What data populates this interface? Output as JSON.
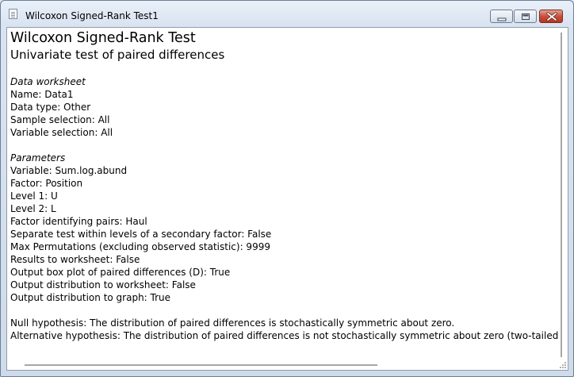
{
  "window": {
    "title": "Wilcoxon Signed-Rank Test1"
  },
  "report": {
    "title": "Wilcoxon Signed-Rank Test",
    "subtitle": "Univariate test of paired differences",
    "data_section": {
      "heading": "Data worksheet",
      "lines": [
        "Name: Data1",
        "Data type: Other",
        "Sample selection: All",
        "Variable selection: All"
      ]
    },
    "params_section": {
      "heading": "Parameters",
      "lines": [
        "Variable: Sum.log.abund",
        "Factor: Position",
        "Level 1: U",
        "Level 2: L",
        "Factor identifying pairs: Haul",
        "Separate test within levels of a secondary factor: False",
        "Max Permutations (excluding observed statistic): 9999",
        "Results to worksheet: False",
        "Output box plot of paired differences (D): True",
        "Output distribution to worksheet: False",
        "Output distribution to graph: True"
      ]
    },
    "hypotheses": {
      "null": "Null hypothesis: The distribution of paired differences is stochastically symmetric about zero.",
      "alternative": "Alternative hypothesis: The distribution of paired differences is not stochastically symmetric about zero (two-tailed)."
    }
  },
  "icons": {
    "app": "document-icon",
    "minimize": "minimize-icon",
    "maximize": "maximize-icon",
    "close": "close-icon"
  }
}
